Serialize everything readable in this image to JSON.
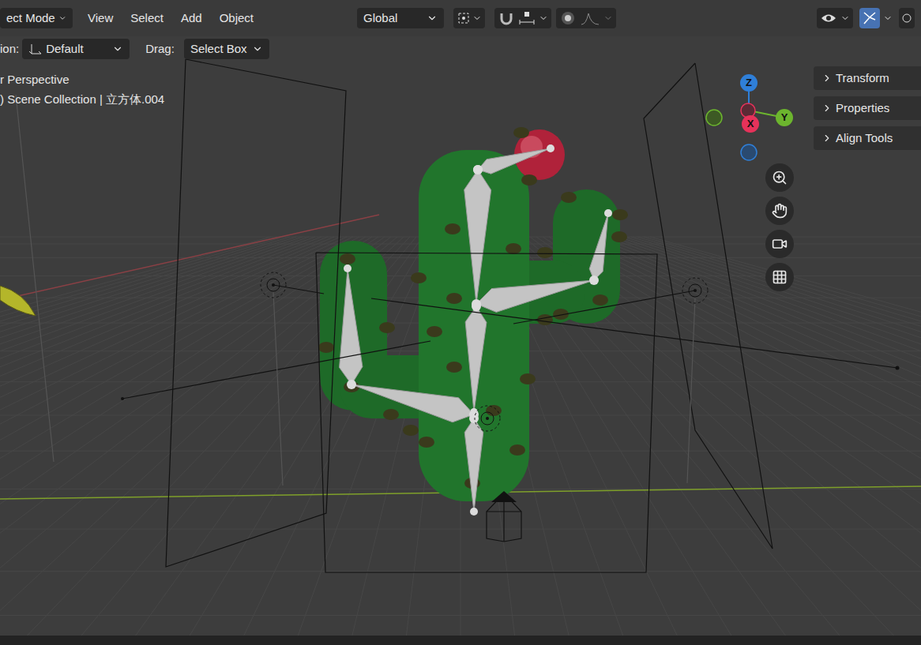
{
  "header": {
    "mode": "ect Mode",
    "menus": [
      "View",
      "Select",
      "Add",
      "Object"
    ],
    "orientation": "Global",
    "gizmo_toggle_active": true,
    "overlay_toggle_active": false
  },
  "tool_settings": {
    "orientation_label": "ion:",
    "orientation_value": "Default",
    "drag_label": "Drag:",
    "drag_value": "Select Box"
  },
  "viewport": {
    "view_name": "r Perspective",
    "collection": ") Scene Collection | 立方体.004"
  },
  "gizmo": {
    "axes": [
      {
        "label": "Z",
        "color": "#2f7fd8"
      },
      {
        "label": "X",
        "color": "#e6325a"
      },
      {
        "label": "Y",
        "color": "#6cb52e"
      }
    ]
  },
  "side_panels": [
    {
      "label": "Transform",
      "expanded": false
    },
    {
      "label": "Properties",
      "expanded": false
    },
    {
      "label": "Align Tools",
      "expanded": false
    }
  ]
}
